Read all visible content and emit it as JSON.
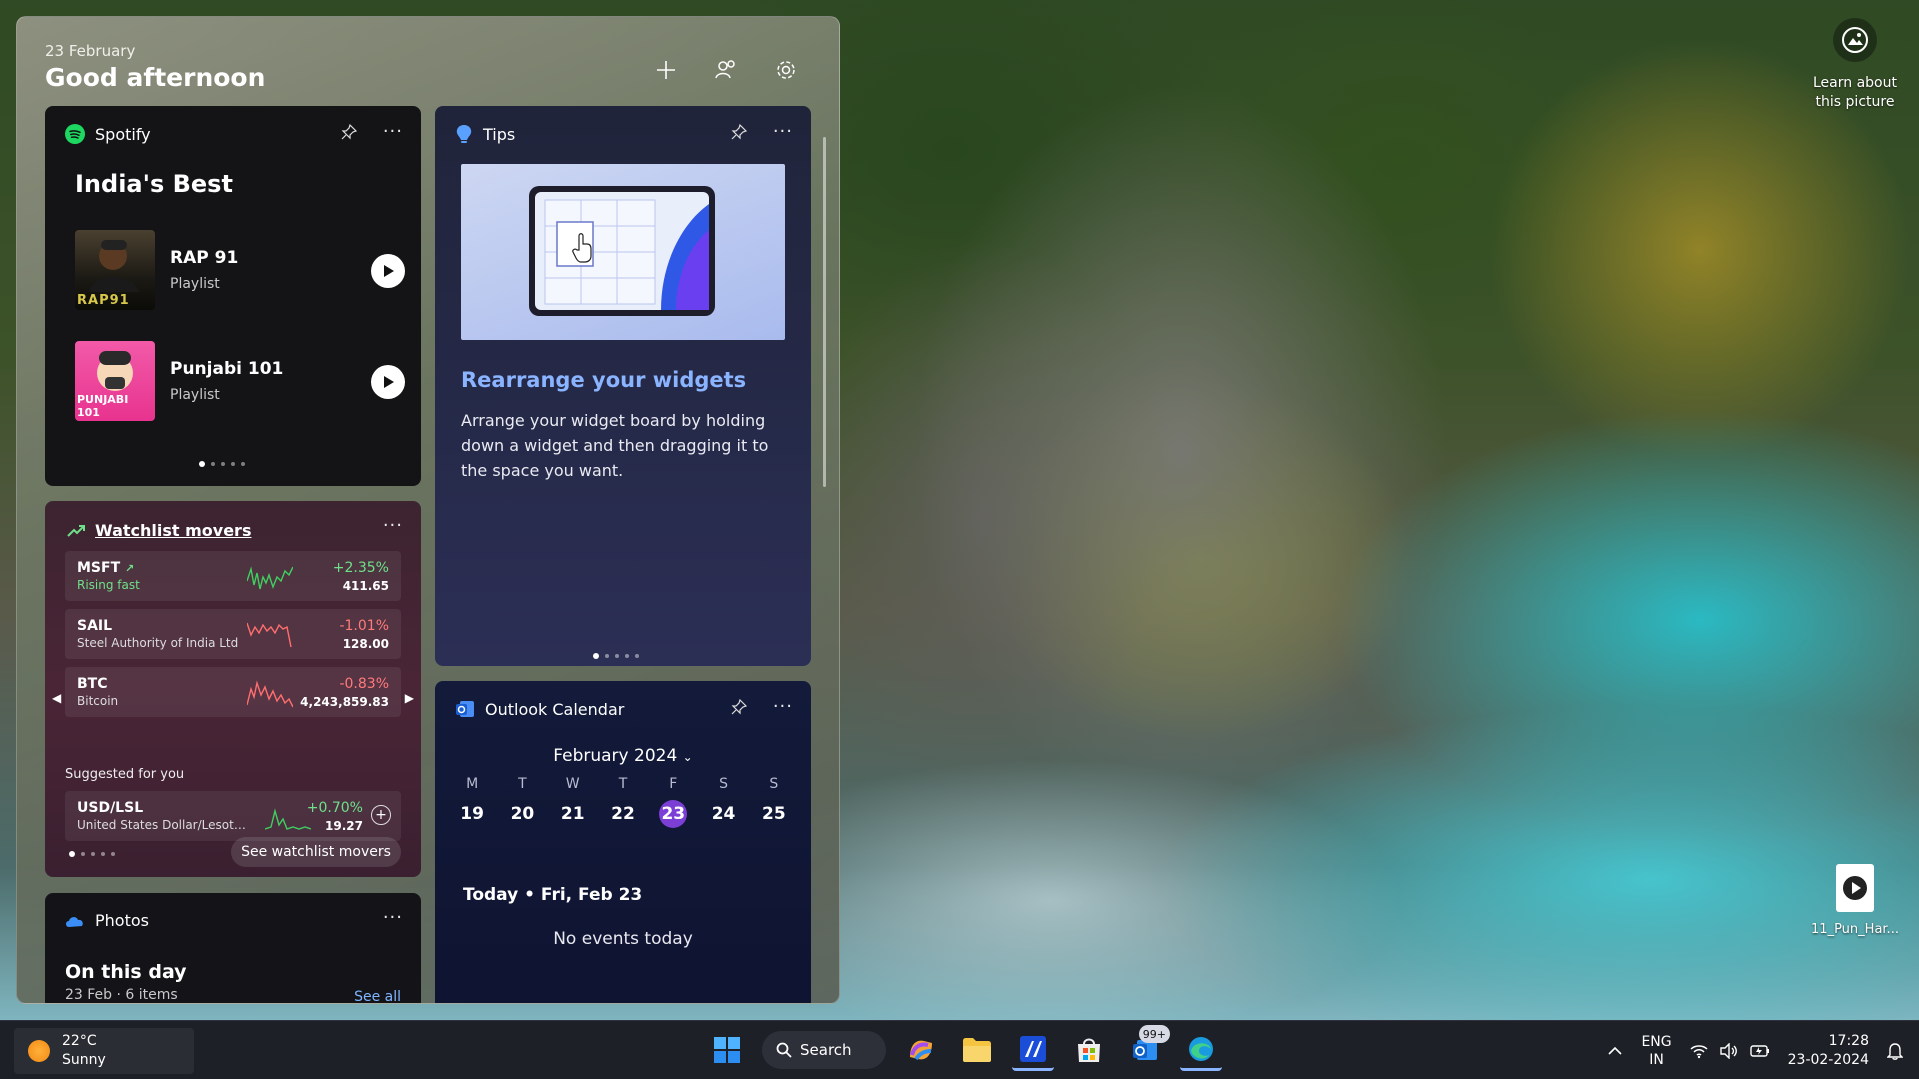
{
  "board": {
    "date": "23 February",
    "greeting": "Good afternoon"
  },
  "spotify": {
    "app": "Spotify",
    "title": "India's Best",
    "items": [
      {
        "name": "RAP 91",
        "type": "Playlist",
        "art_text": "RAP91"
      },
      {
        "name": "Punjabi 101",
        "type": "Playlist",
        "art_text": "PUNJABI 101"
      }
    ]
  },
  "watchlist": {
    "title": "Watchlist movers",
    "rows": [
      {
        "symbol": "MSFT",
        "desc": "Rising fast",
        "pct": "+2.35%",
        "price": "411.65",
        "trend": "up"
      },
      {
        "symbol": "SAIL",
        "desc": "Steel Authority of India Ltd",
        "pct": "-1.01%",
        "price": "128.00",
        "trend": "down"
      },
      {
        "symbol": "BTC",
        "desc": "Bitcoin",
        "pct": "-0.83%",
        "price": "4,243,859.83",
        "trend": "down"
      }
    ],
    "suggested_label": "Suggested for you",
    "suggested": {
      "symbol": "USD/LSL",
      "desc": "United States Dollar/Lesoth...",
      "pct": "+0.70%",
      "price": "19.27",
      "trend": "up"
    },
    "cta": "See watchlist movers"
  },
  "photos": {
    "app": "Photos",
    "title": "On this day",
    "sub": "23 Feb · 6 items",
    "see_all": "See all"
  },
  "tips": {
    "app": "Tips",
    "title": "Rearrange your widgets",
    "body": "Arrange your widget board by holding down a widget and then dragging it to the space you want."
  },
  "outlook": {
    "app": "Outlook Calendar",
    "month": "February 2024",
    "day_names": [
      "M",
      "T",
      "W",
      "T",
      "F",
      "S",
      "S"
    ],
    "days": [
      "19",
      "20",
      "21",
      "22",
      "23",
      "24",
      "25"
    ],
    "selected_day": "23",
    "today": "Today • Fri, Feb 23",
    "no_events": "No events today"
  },
  "desktop": {
    "learn": "Learn about this picture",
    "file": "11_Pun_Har..."
  },
  "taskbar": {
    "temp": "22°C",
    "condition": "Sunny",
    "search": "Search",
    "badge": "99+",
    "lang1": "ENG",
    "lang2": "IN",
    "time": "17:28",
    "date": "23-02-2024"
  },
  "colors": {
    "accent_purple": "#7b3fd6",
    "tips_title": "#8ab4ff",
    "stock_up": "#6fe08a",
    "stock_down": "#ff7a7a",
    "spotify_green": "#1ed760"
  }
}
